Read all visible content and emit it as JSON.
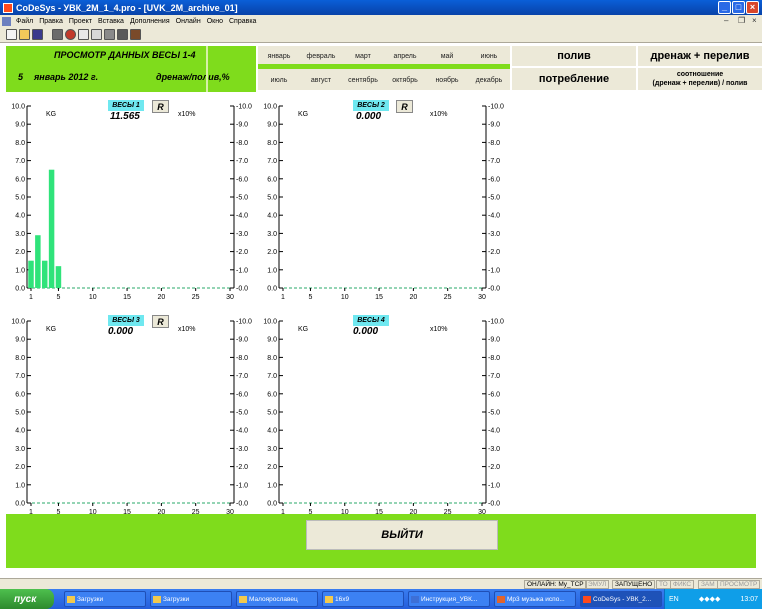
{
  "window": {
    "title": "CoDeSys - УВК_2М_1_4.pro - [UVK_2M_archive_01]"
  },
  "menu": [
    "Файл",
    "Правка",
    "Проект",
    "Вставка",
    "Дополнения",
    "Онлайн",
    "Окно",
    "Справка"
  ],
  "header": {
    "title": "ПРОСМОТР ДАННЫХ   ВЕСЫ   1-4",
    "day": "5",
    "month_year": "январь  2012 г.",
    "ratio_label": "дренаж/полив,%"
  },
  "months": [
    "январь",
    "февраль",
    "март",
    "апрель",
    "май",
    "июнь",
    "июль",
    "август",
    "сентябрь",
    "октябрь",
    "ноябрь",
    "декабрь"
  ],
  "right_buttons": {
    "poliv": "полив",
    "drenazh": "дренаж + перелив",
    "potreblenie": "потребление",
    "ratio_line1": "соотношение",
    "ratio_line2": "(дренаж + перелив) / полив"
  },
  "charts": [
    {
      "label": "ВЕСЫ 1",
      "value": "11.565",
      "has_r": true,
      "r_label": "R",
      "unit": "KG",
      "right_unit": "x10%"
    },
    {
      "label": "ВЕСЫ 2",
      "value": "0.000",
      "has_r": true,
      "r_label": "R",
      "unit": "KG",
      "right_unit": "x10%"
    },
    {
      "label": "ВЕСЫ 3",
      "value": "0.000",
      "has_r": true,
      "r_label": "R",
      "unit": "KG",
      "right_unit": "x10%"
    },
    {
      "label": "ВЕСЫ 4",
      "value": "0.000",
      "has_r": false,
      "unit": "KG",
      "right_unit": "x10%"
    }
  ],
  "chart_data": [
    {
      "type": "bar",
      "title": "ВЕСЫ 1",
      "x": [
        1,
        2,
        3,
        4,
        5
      ],
      "values": [
        1.5,
        2.9,
        1.5,
        6.5,
        1.2
      ],
      "xlim": [
        1,
        30
      ],
      "ylim": [
        0,
        10
      ],
      "y_ticks": [
        "0.0",
        "1.0",
        "2.0",
        "3.0",
        "4.0",
        "5.0",
        "6.0",
        "7.0",
        "8.0",
        "9.0",
        "10.0"
      ],
      "x_ticks": [
        "1",
        "5",
        "10",
        "15",
        "20",
        "25",
        "30"
      ],
      "y2_ticks": [
        "0.0",
        "1.0",
        "2.0",
        "3.0",
        "4.0",
        "5.0",
        "6.0",
        "7.0",
        "8.0",
        "9.0",
        "10.0"
      ],
      "bar_color": "#2fe37a"
    },
    {
      "type": "bar",
      "title": "ВЕСЫ 2",
      "x": [],
      "values": [],
      "xlim": [
        1,
        30
      ],
      "ylim": [
        0,
        10
      ],
      "y_ticks": [
        "0.0",
        "1.0",
        "2.0",
        "3.0",
        "4.0",
        "5.0",
        "6.0",
        "7.0",
        "8.0",
        "9.0",
        "10.0"
      ],
      "x_ticks": [
        "1",
        "5",
        "10",
        "15",
        "20",
        "25",
        "30"
      ],
      "y2_ticks": [
        "0.0",
        "1.0",
        "2.0",
        "3.0",
        "4.0",
        "5.0",
        "6.0",
        "7.0",
        "8.0",
        "9.0",
        "10.0"
      ],
      "bar_color": "#2fe37a"
    },
    {
      "type": "bar",
      "title": "ВЕСЫ 3",
      "x": [],
      "values": [],
      "xlim": [
        1,
        30
      ],
      "ylim": [
        0,
        10
      ],
      "y_ticks": [
        "0.0",
        "1.0",
        "2.0",
        "3.0",
        "4.0",
        "5.0",
        "6.0",
        "7.0",
        "8.0",
        "9.0",
        "10.0"
      ],
      "x_ticks": [
        "1",
        "5",
        "10",
        "15",
        "20",
        "25",
        "30"
      ],
      "y2_ticks": [
        "0.0",
        "1.0",
        "2.0",
        "3.0",
        "4.0",
        "5.0",
        "6.0",
        "7.0",
        "8.0",
        "9.0",
        "10.0"
      ],
      "bar_color": "#2fe37a"
    },
    {
      "type": "bar",
      "title": "ВЕСЫ 4",
      "x": [],
      "values": [],
      "xlim": [
        1,
        30
      ],
      "ylim": [
        0,
        10
      ],
      "y_ticks": [
        "0.0",
        "1.0",
        "2.0",
        "3.0",
        "4.0",
        "5.0",
        "6.0",
        "7.0",
        "8.0",
        "9.0",
        "10.0"
      ],
      "x_ticks": [
        "1",
        "5",
        "10",
        "15",
        "20",
        "25",
        "30"
      ],
      "y2_ticks": [
        "0.0",
        "1.0",
        "2.0",
        "3.0",
        "4.0",
        "5.0",
        "6.0",
        "7.0",
        "8.0",
        "9.0",
        "10.0"
      ],
      "bar_color": "#2fe37a"
    }
  ],
  "exit_label": "ВЫЙТИ",
  "status": [
    "ОНЛАЙН: My_TCP",
    "ЭМУЛ",
    "ЗАПУЩЕНО",
    "ТО",
    "ФИКС",
    "ЗАМ",
    "ПРОСМОТР"
  ],
  "taskbar": {
    "start": "пуск",
    "items": [
      "Загрузки",
      "Загрузки",
      "Малоярославец",
      "16x9",
      "Инструкция_УВК...",
      "Mp3 музыка испо...",
      "CoDeSys - УВК_2..."
    ],
    "lang": "EN",
    "clock": "13:07"
  },
  "colors": {
    "accent_green": "#7fdc1c",
    "bar_green": "#2fe37a",
    "label_cyan": "#6fe8f0",
    "titlebar_blue": "#0a5fd8"
  }
}
